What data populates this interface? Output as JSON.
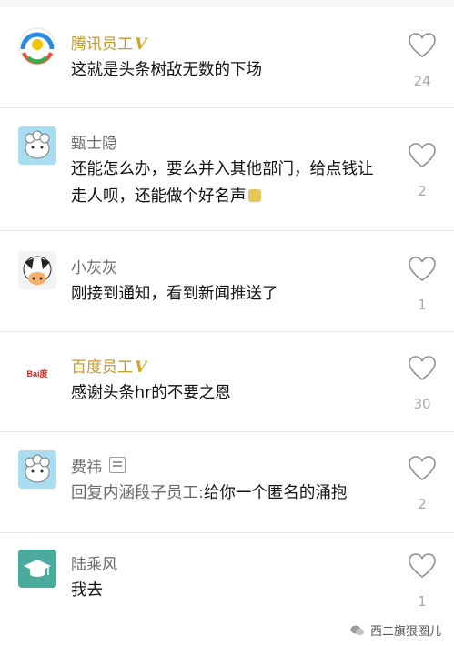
{
  "comments": [
    {
      "name": "腾讯员工",
      "verified_badge": "V",
      "official": true,
      "avatar_icon": "tencent-logo-icon",
      "text": "这就是头条树敌无数的下场",
      "likes": "24"
    },
    {
      "name": "甄士隐",
      "official": false,
      "avatar_icon": "default-sheep-avatar-icon",
      "text": "还能怎么办，要么并入其他部门，给点钱让走人呗，还能做个好名声",
      "likes": "2"
    },
    {
      "name": "小灰灰",
      "official": false,
      "avatar_icon": "cow-avatar-icon",
      "text": "刚接到通知，看到新闻推送了",
      "likes": "1"
    },
    {
      "name": "百度员工",
      "verified_badge": "V",
      "official": true,
      "avatar_icon": "baidu-logo-icon",
      "avatar_text": "Bai度",
      "text": "感谢头条hr的不要之恩",
      "likes": "30"
    },
    {
      "name": "费祎",
      "official": false,
      "avatar_icon": "default-sheep-avatar-icon",
      "reply_prefix": "回复内涵段子员工:",
      "text": "给你一个匿名的涌抱",
      "likes": "2"
    },
    {
      "name": "陆乘风",
      "official": false,
      "avatar_icon": "graduation-cap-avatar-icon",
      "text": "我去",
      "likes": "1"
    }
  ],
  "watermark": "西二旗狠圈儿",
  "colors": {
    "official_name": "#c79a2c",
    "name": "#6b6b6b",
    "likes": "#a9a9a9"
  }
}
